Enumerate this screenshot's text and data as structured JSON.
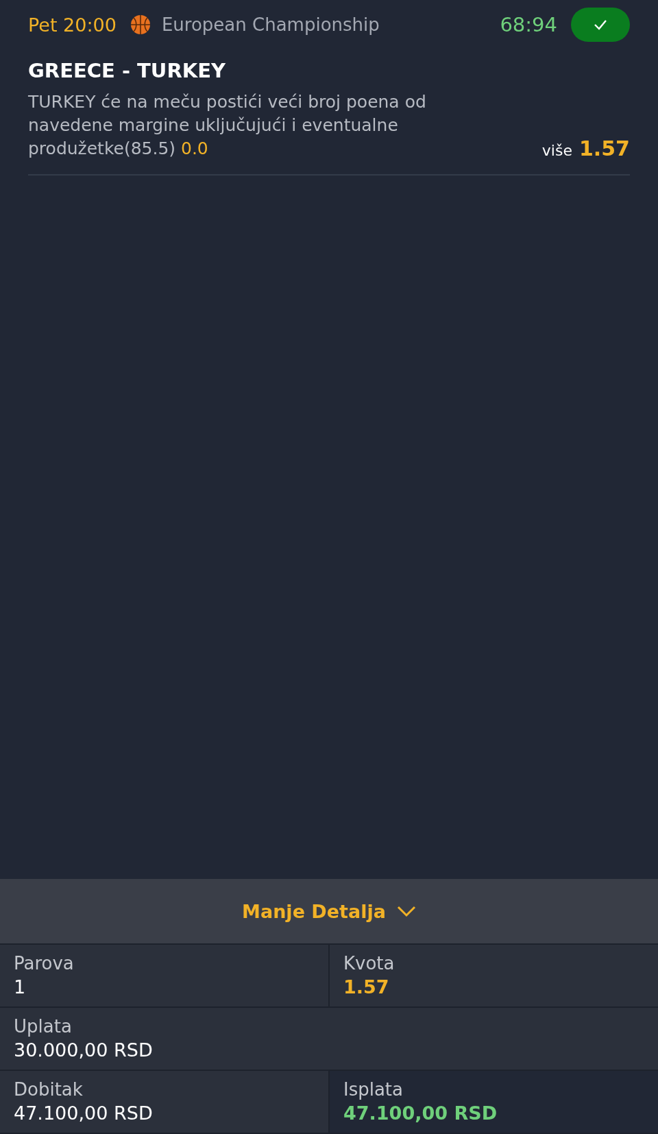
{
  "bet": {
    "day_time": "Pet 20:00",
    "competition": "European Championship",
    "score": "68:94",
    "won": true,
    "match": "GREECE - TURKEY",
    "description": "TURKEY će na meču postići veći broj poena od navedene margine uključujući i eventualne produžetke(85.5)",
    "line_value": "0.0",
    "pick": "više",
    "odds": "1.57"
  },
  "details_toggle": {
    "label": "Manje Detalja",
    "expanded": true
  },
  "summary_rows": [
    [
      {
        "label": "Parova",
        "value": "1",
        "kind": "plain"
      },
      {
        "label": "Kvota",
        "value": "1.57",
        "kind": "odds"
      }
    ],
    [
      {
        "label": "Uplata",
        "value": "30.000,00 RSD",
        "kind": "plain"
      }
    ],
    [
      {
        "label": "Dobitak",
        "value": "47.100,00 RSD",
        "kind": "plain"
      },
      {
        "label": "Isplata",
        "value": "47.100,00 RSD",
        "kind": "payout"
      }
    ]
  ]
}
